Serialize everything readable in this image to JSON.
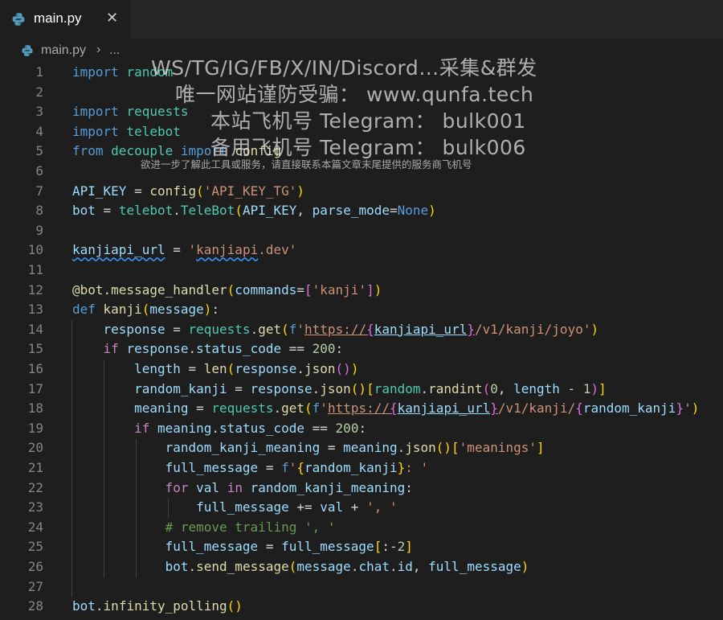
{
  "tab": {
    "title": "main.py",
    "close": "✕"
  },
  "breadcrumb": {
    "file": "main.py",
    "separator": "›",
    "more": "..."
  },
  "watermark": {
    "line1": "WS/TG/IG/FB/X/IN/Discord…采集&群发",
    "line2": "唯一网站谨防受骗： www.qunfa.tech",
    "line3": "本站飞机号 Telegram： bulk001",
    "line4": "备用飞机号 Telegram： bulk006",
    "line5": "欲进一步了解此工具或服务，请直接联系本篇文章末尾提供的服务商飞机号"
  },
  "code": {
    "line_numbers": [
      "1",
      "2",
      "3",
      "4",
      "5",
      "6",
      "7",
      "8",
      "9",
      "10",
      "11",
      "12",
      "13",
      "14",
      "15",
      "16",
      "17",
      "18",
      "19",
      "20",
      "21",
      "22",
      "23",
      "24",
      "25",
      "26",
      "27",
      "28"
    ],
    "lines": [
      [
        [
          "kw",
          "import"
        ],
        [
          "pl",
          " "
        ],
        [
          "mod",
          "random"
        ]
      ],
      [],
      [
        [
          "kw",
          "import"
        ],
        [
          "pl",
          " "
        ],
        [
          "mod",
          "requests"
        ]
      ],
      [
        [
          "kw",
          "import"
        ],
        [
          "pl",
          " "
        ],
        [
          "mod",
          "telebot"
        ]
      ],
      [
        [
          "kw",
          "from"
        ],
        [
          "pl",
          " "
        ],
        [
          "mod",
          "decouple"
        ],
        [
          "pl",
          " "
        ],
        [
          "kw",
          "import"
        ],
        [
          "pl",
          " "
        ],
        [
          "fn",
          "config"
        ]
      ],
      [],
      [
        [
          "v",
          "API_KEY"
        ],
        [
          "pl",
          " = "
        ],
        [
          "fn",
          "config"
        ],
        [
          "p1",
          "("
        ],
        [
          "s",
          "'API_KEY_TG'"
        ],
        [
          "p1",
          ")"
        ]
      ],
      [
        [
          "v",
          "bot"
        ],
        [
          "pl",
          " = "
        ],
        [
          "mod",
          "telebot"
        ],
        [
          "pl",
          "."
        ],
        [
          "mod",
          "TeleBot"
        ],
        [
          "p1",
          "("
        ],
        [
          "v",
          "API_KEY"
        ],
        [
          "pl",
          ", "
        ],
        [
          "v",
          "parse_mode"
        ],
        [
          "pl",
          "="
        ],
        [
          "kw",
          "None"
        ],
        [
          "p1",
          ")"
        ]
      ],
      [],
      [
        [
          "vsq",
          "kanjiapi_url"
        ],
        [
          "pl",
          " = "
        ],
        [
          "s",
          "'"
        ],
        [
          "ssq",
          "kanjiapi"
        ],
        [
          "s",
          ".dev'"
        ]
      ],
      [],
      [
        [
          "fn",
          "@bot.message_handler"
        ],
        [
          "p1",
          "("
        ],
        [
          "v",
          "commands"
        ],
        [
          "pl",
          "="
        ],
        [
          "p2",
          "["
        ],
        [
          "s",
          "'kanji'"
        ],
        [
          "p2",
          "]"
        ],
        [
          "p1",
          ")"
        ]
      ],
      [
        [
          "kw",
          "def"
        ],
        [
          "pl",
          " "
        ],
        [
          "fn",
          "kanji"
        ],
        [
          "p1",
          "("
        ],
        [
          "v",
          "message"
        ],
        [
          "p1",
          ")"
        ],
        [
          "pl",
          ":"
        ]
      ],
      [
        [
          "pl",
          "    "
        ],
        [
          "v",
          "response"
        ],
        [
          "pl",
          " = "
        ],
        [
          "mod",
          "requests"
        ],
        [
          "pl",
          "."
        ],
        [
          "fn",
          "get"
        ],
        [
          "p1",
          "("
        ],
        [
          "kw",
          "f"
        ],
        [
          "s",
          "'"
        ],
        [
          "surl",
          "https://"
        ],
        [
          "p2u",
          "{"
        ],
        [
          "vu",
          "kanjiapi_url"
        ],
        [
          "p2u",
          "}"
        ],
        [
          "s",
          "/v1/kanji/joyo'"
        ],
        [
          "p1",
          ")"
        ]
      ],
      [
        [
          "pl",
          "    "
        ],
        [
          "ck",
          "if"
        ],
        [
          "pl",
          " "
        ],
        [
          "v",
          "response"
        ],
        [
          "pl",
          "."
        ],
        [
          "v",
          "status_code"
        ],
        [
          "pl",
          " == "
        ],
        [
          "n",
          "200"
        ],
        [
          "pl",
          ":"
        ]
      ],
      [
        [
          "pl",
          "        "
        ],
        [
          "v",
          "length"
        ],
        [
          "pl",
          " = "
        ],
        [
          "fn",
          "len"
        ],
        [
          "p1",
          "("
        ],
        [
          "v",
          "response"
        ],
        [
          "pl",
          "."
        ],
        [
          "fn",
          "json"
        ],
        [
          "p2",
          "()"
        ],
        [
          "p1",
          ")"
        ]
      ],
      [
        [
          "pl",
          "        "
        ],
        [
          "v",
          "random_kanji"
        ],
        [
          "pl",
          " = "
        ],
        [
          "v",
          "response"
        ],
        [
          "pl",
          "."
        ],
        [
          "fn",
          "json"
        ],
        [
          "p1",
          "()"
        ],
        [
          "p1",
          "["
        ],
        [
          "mod",
          "random"
        ],
        [
          "pl",
          "."
        ],
        [
          "fn",
          "randint"
        ],
        [
          "p2",
          "("
        ],
        [
          "n",
          "0"
        ],
        [
          "pl",
          ", "
        ],
        [
          "v",
          "length"
        ],
        [
          "pl",
          " - "
        ],
        [
          "n",
          "1"
        ],
        [
          "p2",
          ")"
        ],
        [
          "p1",
          "]"
        ]
      ],
      [
        [
          "pl",
          "        "
        ],
        [
          "v",
          "meaning"
        ],
        [
          "pl",
          " = "
        ],
        [
          "mod",
          "requests"
        ],
        [
          "pl",
          "."
        ],
        [
          "fn",
          "get"
        ],
        [
          "p1",
          "("
        ],
        [
          "kw",
          "f"
        ],
        [
          "s",
          "'"
        ],
        [
          "surl",
          "https://"
        ],
        [
          "p2u",
          "{"
        ],
        [
          "vu",
          "kanjiapi_url"
        ],
        [
          "p2u",
          "}"
        ],
        [
          "s",
          "/v1/kanji/"
        ],
        [
          "p2",
          "{"
        ],
        [
          "v",
          "random_kanji"
        ],
        [
          "p2",
          "}"
        ],
        [
          "s",
          "'"
        ],
        [
          "p1",
          ")"
        ]
      ],
      [
        [
          "pl",
          "        "
        ],
        [
          "ck",
          "if"
        ],
        [
          "pl",
          " "
        ],
        [
          "v",
          "meaning"
        ],
        [
          "pl",
          "."
        ],
        [
          "v",
          "status_code"
        ],
        [
          "pl",
          " == "
        ],
        [
          "n",
          "200"
        ],
        [
          "pl",
          ":"
        ]
      ],
      [
        [
          "pl",
          "            "
        ],
        [
          "v",
          "random_kanji_meaning"
        ],
        [
          "pl",
          " = "
        ],
        [
          "v",
          "meaning"
        ],
        [
          "pl",
          "."
        ],
        [
          "fn",
          "json"
        ],
        [
          "p1",
          "()"
        ],
        [
          "p1",
          "["
        ],
        [
          "s",
          "'meanings'"
        ],
        [
          "p1",
          "]"
        ]
      ],
      [
        [
          "pl",
          "            "
        ],
        [
          "v",
          "full_message"
        ],
        [
          "pl",
          " = "
        ],
        [
          "kw",
          "f"
        ],
        [
          "s",
          "'"
        ],
        [
          "p1",
          "{"
        ],
        [
          "v",
          "random_kanji"
        ],
        [
          "p1",
          "}"
        ],
        [
          "s",
          ": '"
        ]
      ],
      [
        [
          "pl",
          "            "
        ],
        [
          "ck",
          "for"
        ],
        [
          "pl",
          " "
        ],
        [
          "v",
          "val"
        ],
        [
          "pl",
          " "
        ],
        [
          "ck",
          "in"
        ],
        [
          "pl",
          " "
        ],
        [
          "v",
          "random_kanji_meaning"
        ],
        [
          "pl",
          ":"
        ]
      ],
      [
        [
          "pl",
          "                "
        ],
        [
          "v",
          "full_message"
        ],
        [
          "pl",
          " += "
        ],
        [
          "v",
          "val"
        ],
        [
          "pl",
          " + "
        ],
        [
          "s",
          "', '"
        ]
      ],
      [
        [
          "pl",
          "            "
        ],
        [
          "c",
          "# remove trailing ', '"
        ]
      ],
      [
        [
          "pl",
          "            "
        ],
        [
          "v",
          "full_message"
        ],
        [
          "pl",
          " = "
        ],
        [
          "v",
          "full_message"
        ],
        [
          "p1",
          "["
        ],
        [
          "pl",
          ":-"
        ],
        [
          "n",
          "2"
        ],
        [
          "p1",
          "]"
        ]
      ],
      [
        [
          "pl",
          "            "
        ],
        [
          "v",
          "bot"
        ],
        [
          "pl",
          "."
        ],
        [
          "fn",
          "send_message"
        ],
        [
          "p1",
          "("
        ],
        [
          "v",
          "message"
        ],
        [
          "pl",
          "."
        ],
        [
          "v",
          "chat"
        ],
        [
          "pl",
          "."
        ],
        [
          "v",
          "id"
        ],
        [
          "pl",
          ", "
        ],
        [
          "v",
          "full_message"
        ],
        [
          "p1",
          ")"
        ]
      ],
      [],
      [
        [
          "v",
          "bot"
        ],
        [
          "pl",
          "."
        ],
        [
          "fn",
          "infinity_polling"
        ],
        [
          "p1",
          "()"
        ]
      ]
    ]
  },
  "colors": {
    "background": "#1e1e1e",
    "tabbar": "#252526",
    "keyword": "#569cd6",
    "control": "#c586c0",
    "type": "#4ec9b0",
    "function": "#dcdcaa",
    "variable": "#9cdcfe",
    "string": "#ce9178",
    "number": "#b5cea8",
    "comment": "#6a9955"
  },
  "icons": {
    "file_type": "python-icon",
    "close": "close-icon"
  }
}
